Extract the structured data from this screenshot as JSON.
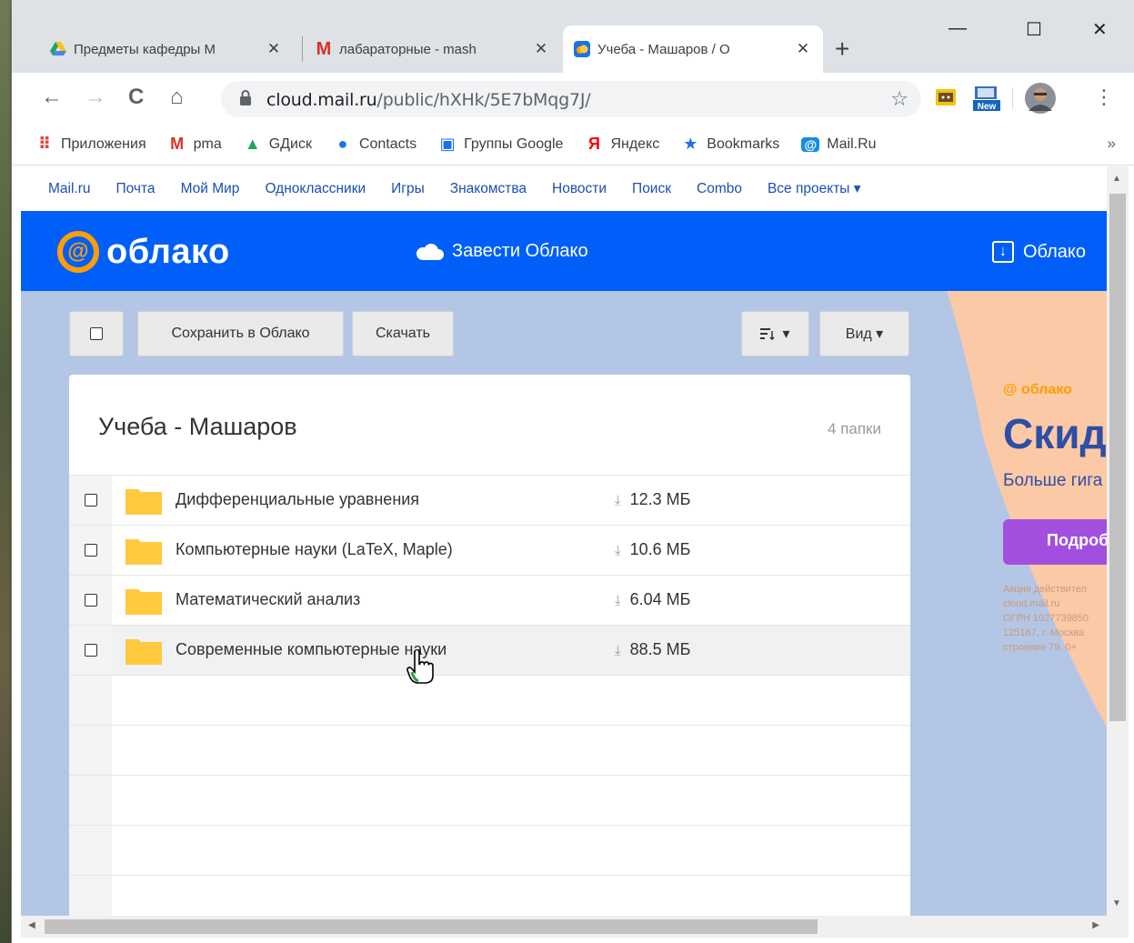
{
  "tabs": [
    {
      "title": "Предметы кафедры М",
      "favicon": "google-drive-icon"
    },
    {
      "title": "лабараторные - mash",
      "favicon": "gmail-icon"
    },
    {
      "title": "Учеба - Машаров / О",
      "favicon": "mail-cloud-icon",
      "active": true
    }
  ],
  "tab_close": "✕",
  "new_tab": "+",
  "window_controls": {
    "minimize": "—",
    "maximize": "☐",
    "close": "✕"
  },
  "nav": {
    "back": "←",
    "forward": "→",
    "reload": "C",
    "home": "⌂",
    "menu": "⋮"
  },
  "url": {
    "host": "cloud.mail.ru",
    "path": "/public/hXHk/5E7bMqg7J/"
  },
  "bookmark_star": "☆",
  "ext_badge": "New",
  "bookmarks": [
    {
      "label": "Приложения",
      "icon": "apps-grid-icon",
      "glyph": "⠿",
      "color": "#ea4335"
    },
    {
      "label": "pma",
      "icon": "gmail-icon",
      "glyph": "M",
      "color": "#d93025"
    },
    {
      "label": "GДиск",
      "icon": "google-drive-icon",
      "glyph": "▲",
      "color": "#1fa463"
    },
    {
      "label": "Contacts",
      "icon": "contacts-icon",
      "glyph": "●",
      "color": "#1a73e8"
    },
    {
      "label": "Группы Google",
      "icon": "groups-icon",
      "glyph": "▣",
      "color": "#1a73e8"
    },
    {
      "label": "Яндекс",
      "icon": "yandex-icon",
      "glyph": "Я",
      "color": "#ff0000"
    },
    {
      "label": "Bookmarks",
      "icon": "star-icon",
      "glyph": "★",
      "color": "#1a73e8"
    },
    {
      "label": "Mail.Ru",
      "icon": "mailru-icon",
      "glyph": "@",
      "color": "#168de2"
    }
  ],
  "bookmarks_more": "»",
  "portal_links": [
    "Mail.ru",
    "Почта",
    "Мой Мир",
    "Одноклассники",
    "Игры",
    "Знакомства",
    "Новости",
    "Поиск",
    "Combo",
    "Все проекты ▾"
  ],
  "header": {
    "logo_at": "@",
    "logo_text": "облако",
    "get_cloud": "Завести Облако",
    "right_label": "Облако"
  },
  "toolbar": {
    "save_label": "Сохранить в Облако",
    "download_label": "Скачать",
    "sort_label": "▾",
    "view_label": "Вид ▾"
  },
  "folder": {
    "title": "Учеба - Машаров",
    "count": "4 папки",
    "items": [
      {
        "name": "Дифференциальные уравнения",
        "size": "12.3 МБ"
      },
      {
        "name": "Компьютерные науки (LaTeX, Maple)",
        "size": "10.6 МБ"
      },
      {
        "name": "Математический анализ",
        "size": "6.04 МБ"
      },
      {
        "name": "Современные компьютерные науки",
        "size": "88.5 МБ"
      }
    ],
    "download_glyph": "⤓"
  },
  "promo": {
    "logo": "@ облако",
    "title": "Скидк",
    "subtitle": "Больше гига",
    "button": "Подробн",
    "fine": [
      "Акция действител",
      "cloud.mail.ru",
      "ОГРН 1027739850",
      "125167, г. Москва",
      "строение 79. 0+"
    ]
  },
  "colors": {
    "accent": "#005ff9",
    "page_bg": "#b3c6e6",
    "promo_bg": "#fcc9a7",
    "folder": "#ffc940",
    "promo_btn": "#a24fe0"
  }
}
